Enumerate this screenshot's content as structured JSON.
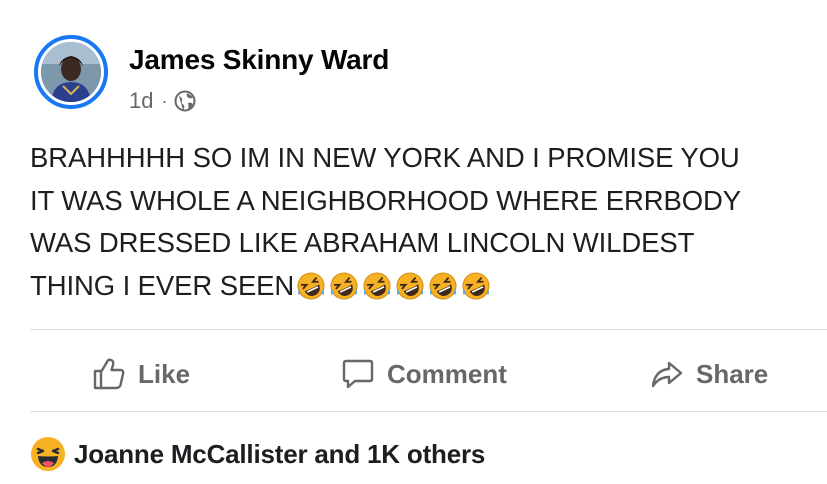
{
  "post": {
    "author": "James Skinny Ward",
    "time": "1d",
    "separator": "·",
    "privacy_icon": "globe-icon",
    "text_lines": [
      "BRAHHHHH SO IM IN NEW YORK AND I PROMISE YOU",
      "IT WAS WHOLE  A NEIGHBORHOOD WHERE ERRBODY",
      "WAS DRESSED LIKE ABRAHAM LINCOLN WILDEST",
      "THING I EVER SEEN"
    ],
    "trailing_emoji": "rolling-on-floor-laughing",
    "trailing_emoji_count": 6
  },
  "actions": {
    "like_label": "Like",
    "comment_label": "Comment",
    "share_label": "Share"
  },
  "reactions": {
    "icon": "haha-reaction-icon",
    "summary": "Joanne McCallister and 1K others"
  },
  "colors": {
    "accent": "#1877f2",
    "secondary_text": "#65676b",
    "divider": "#dadde1",
    "emoji_yellow": "#f7b125"
  }
}
